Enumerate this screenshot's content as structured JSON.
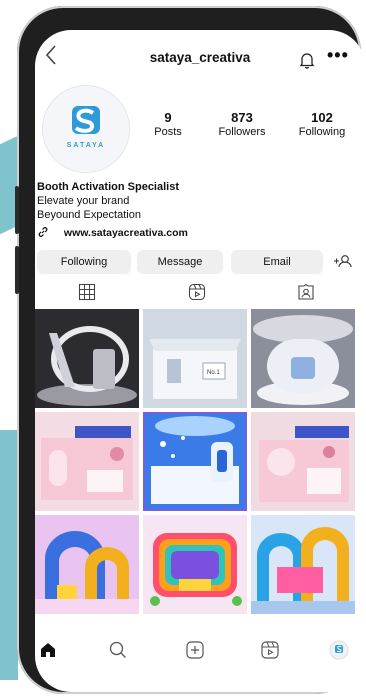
{
  "header": {
    "username": "sataya_creativa",
    "back_icon": "chevron-left-icon",
    "more_label": "•••"
  },
  "profile": {
    "avatar_text": "SATAYA",
    "posts": {
      "count": "9",
      "label": "Posts"
    },
    "followers": {
      "count": "873",
      "label": "Followers"
    },
    "following": {
      "count": "102",
      "label": "Following"
    },
    "bio_title": "Booth Activation Specialist",
    "bio_line1": "Elevate your brand",
    "bio_line2": "Beyound Expectation",
    "website": "www.satayacreativa.com"
  },
  "actions": {
    "following": "Following",
    "message": "Message",
    "email": "Email"
  },
  "tabs": [
    "grid-icon",
    "reels-icon",
    "tagged-icon"
  ],
  "posts": [
    {
      "name": "post-silver-booth",
      "main": "#e9e9ee",
      "accent": "#5a5a60"
    },
    {
      "name": "post-white-kiosk",
      "main": "#dfe6ef",
      "accent": "#9aa7b9",
      "caption": "No.1"
    },
    {
      "name": "post-circular-booth",
      "main": "#eaeaf0",
      "accent": "#8e96b3"
    },
    {
      "name": "post-pink-booth-1",
      "main": "#f6c7d5",
      "accent": "#e28aa8"
    },
    {
      "name": "post-blue-booth",
      "main": "#cfe3fb",
      "accent": "#2a64d6"
    },
    {
      "name": "post-pink-booth-2",
      "main": "#f7c9d6",
      "accent": "#df7f9f"
    },
    {
      "name": "post-colorful-arch-1",
      "main": "#e9c4f1",
      "accent": "#f2b01f"
    },
    {
      "name": "post-rainbow-arch",
      "main": "#f8d6c1",
      "accent": "#ff4f6d"
    },
    {
      "name": "post-colorful-arch-2",
      "main": "#d8e6f7",
      "accent": "#29a3e6"
    }
  ],
  "nav": [
    "home-icon",
    "search-icon",
    "add-post-icon",
    "reels-icon",
    "profile-avatar-icon"
  ]
}
